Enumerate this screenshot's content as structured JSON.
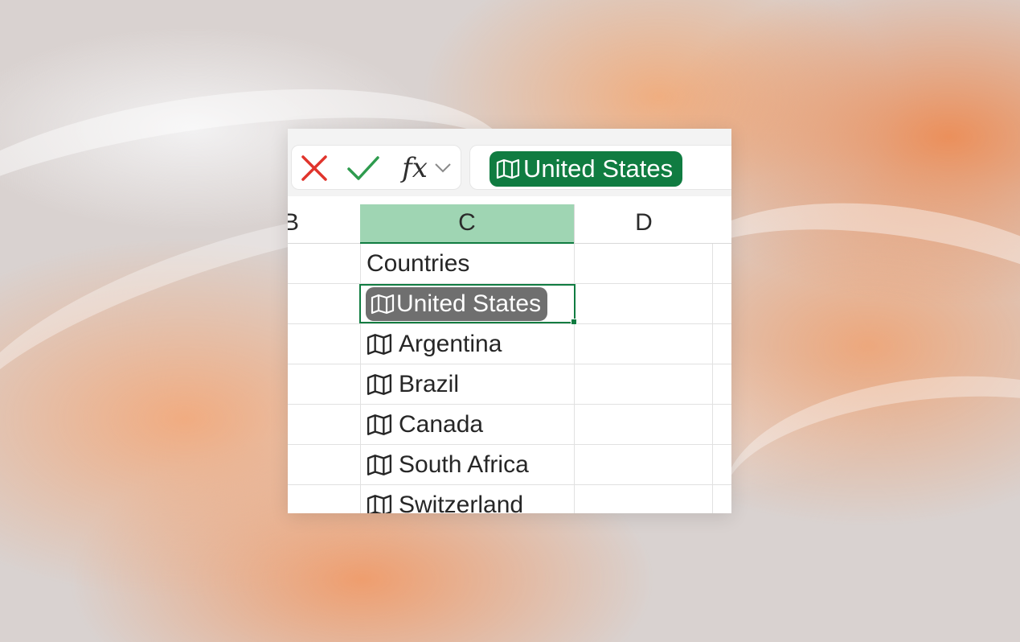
{
  "formula_bar": {
    "cancel_icon": "cancel-x-icon",
    "enter_icon": "enter-check-icon",
    "fx_label": "fx",
    "value": "United States",
    "value_icon": "map-icon"
  },
  "columns": [
    "B",
    "C",
    "D"
  ],
  "cells": {
    "header": "Countries",
    "active_value": "United States",
    "countries": [
      "Argentina",
      "Brazil",
      "Canada",
      "South Africa",
      "Switzerland"
    ]
  },
  "colors": {
    "excel_green": "#107c41",
    "selected_column_header": "#9fd5b3",
    "active_chip_gray": "#6f6f6f",
    "cancel_red": "#e0342c",
    "enter_green": "#2e9b4e"
  }
}
